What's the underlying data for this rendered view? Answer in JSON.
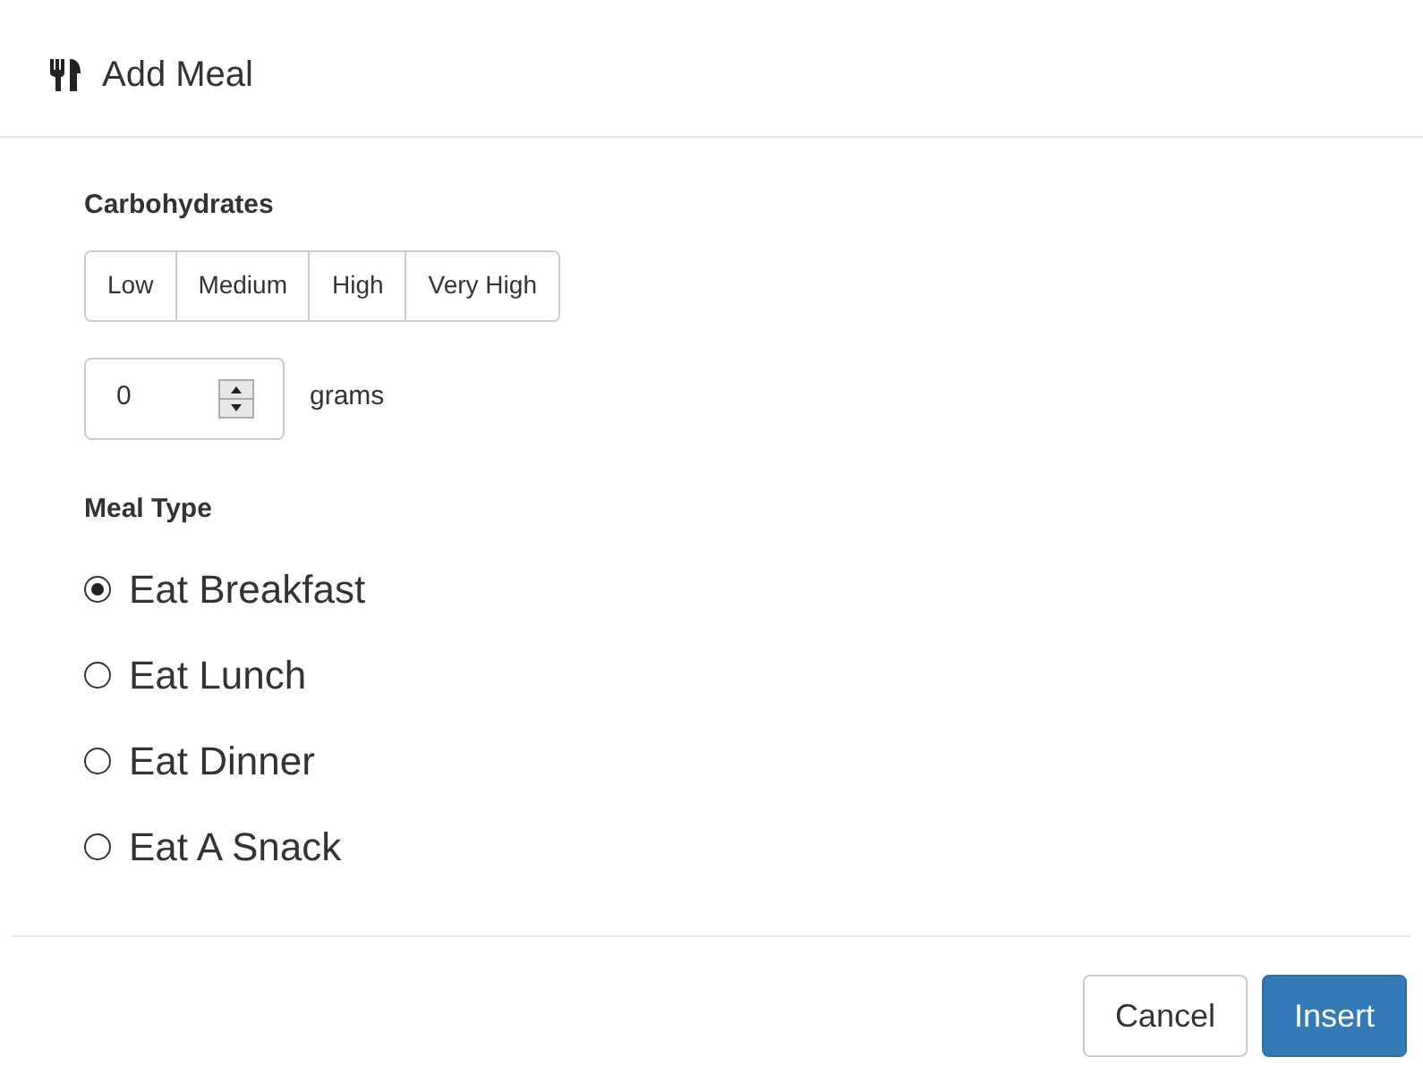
{
  "dialog": {
    "title": "Add Meal"
  },
  "carbohydrates": {
    "label": "Carbohydrates",
    "options": [
      {
        "label": "Low",
        "selected": false
      },
      {
        "label": "Medium",
        "selected": false
      },
      {
        "label": "High",
        "selected": false
      },
      {
        "label": "Very High",
        "selected": false
      }
    ],
    "amount": {
      "value": "0",
      "unit": "grams"
    }
  },
  "meal_type": {
    "label": "Meal Type",
    "options": [
      {
        "label": "Eat Breakfast",
        "selected": true
      },
      {
        "label": "Eat Lunch",
        "selected": false
      },
      {
        "label": "Eat Dinner",
        "selected": false
      },
      {
        "label": "Eat A Snack",
        "selected": false
      }
    ]
  },
  "buttons": [
    {
      "label": "Cancel",
      "kind": "default"
    },
    {
      "label": "Insert",
      "kind": "primary"
    }
  ]
}
